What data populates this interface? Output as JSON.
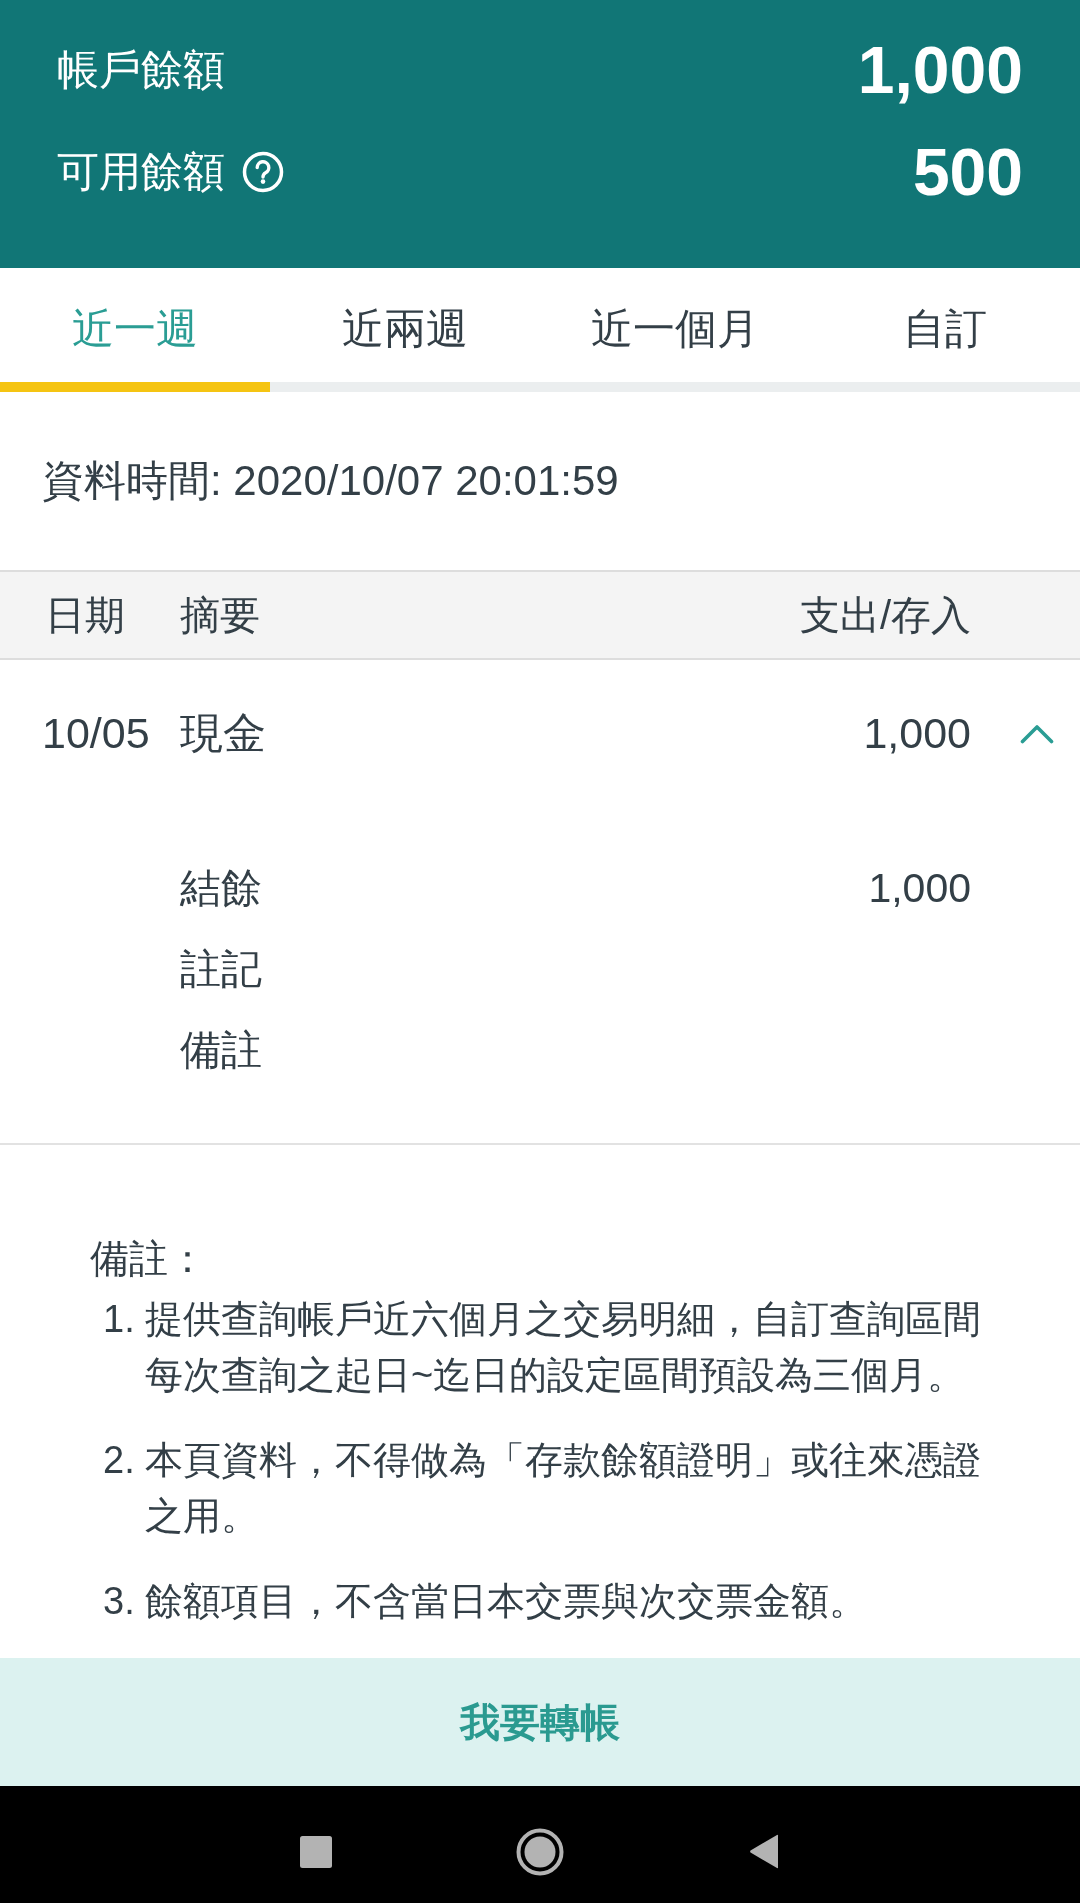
{
  "balances": [
    {
      "label": "帳戶餘額",
      "value": "1,000",
      "help": false
    },
    {
      "label": "可用餘額",
      "value": "500",
      "help": true
    }
  ],
  "tabs": [
    {
      "label": "近一週",
      "selected": true
    },
    {
      "label": "近兩週",
      "selected": false
    },
    {
      "label": "近一個月",
      "selected": false
    },
    {
      "label": "自訂",
      "selected": false
    }
  ],
  "data_time": "資料時間: 2020/10/07 20:01:59",
  "table": {
    "columns": [
      "日期",
      "摘要",
      "支出/存入"
    ],
    "rows": [
      {
        "date": "10/05",
        "summary": "現金",
        "amount": "1,000",
        "expanded": true,
        "details": [
          {
            "label": "結餘",
            "value": "1,000"
          },
          {
            "label": "註記"
          },
          {
            "label": "備註"
          }
        ]
      }
    ]
  },
  "notes": {
    "title": "備註：",
    "items": [
      {
        "number": "1.",
        "text": "提供查詢帳戶近六個月之交易明細，自訂查詢區間每次查詢之起日~迄日的設定區間預設為三個月。"
      },
      {
        "number": "2.",
        "text": "本頁資料，不得做為「存款餘額證明」或往來憑證之用。"
      },
      {
        "number": "3.",
        "text": "餘額項目，不含當日本交票與次交票金額。"
      }
    ]
  },
  "action_button": "我要轉帳"
}
